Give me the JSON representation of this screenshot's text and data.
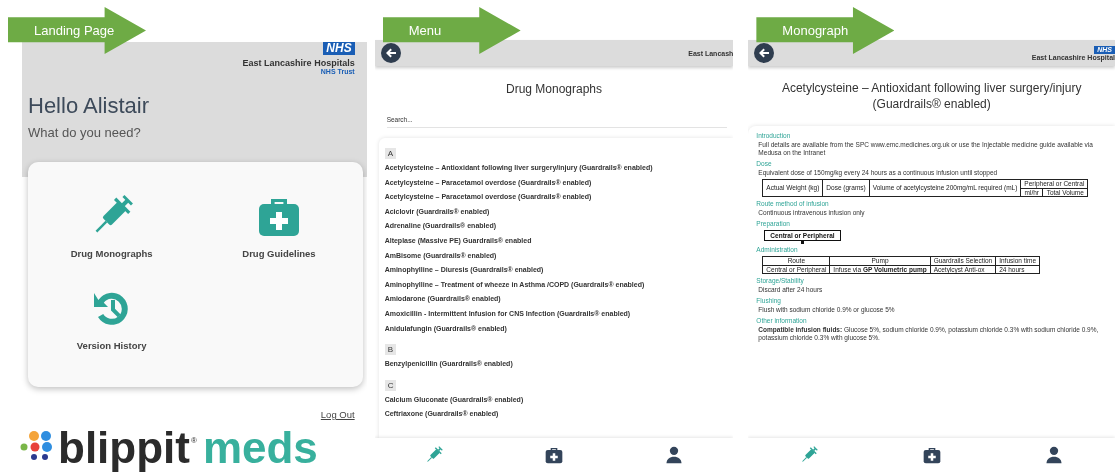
{
  "landing": {
    "banner": "Landing Page",
    "logo": {
      "badge": "NHS",
      "org": "East Lancashire Hospitals",
      "sub": "NHS Trust"
    },
    "greeting": "Hello Alistair",
    "prompt": "What do you need?",
    "tiles": [
      {
        "kind": "syringe",
        "label": "Drug Monographs"
      },
      {
        "kind": "kit",
        "label": "Drug Guidelines"
      },
      {
        "kind": "history",
        "label": "Version History"
      }
    ],
    "logout": "Log Out",
    "brand": {
      "word1": "blippit",
      "mark": "®",
      "word2": "meds"
    }
  },
  "menu": {
    "banner": "Menu",
    "org": "East Lancash",
    "title": "Drug Monographs",
    "search": {
      "placeholder": "Search..."
    },
    "groups": [
      {
        "letter": "A",
        "items": [
          "Acetylcysteine – Antioxidant following liver surgery/injury (Guardrails® enabled)",
          "Acetylcysteine – Paracetamol overdose (Guardrails® enabled)",
          "Acetylcysteine – Paracetamol overdose (Guardrails® enabled)",
          "Aciclovir (Guardrails® enabled)",
          "Adrenaline (Guardrails® enabled)",
          "Alteplase (Massive PE) Guardrails® enabled",
          "AmBisome (Guardrails® enabled)",
          "Aminophylline – Diuresis (Guardrails® enabled)",
          "Aminophylline – Treatment of wheeze in Asthma /COPD (Guardrails® enabled)",
          "Amiodarone (Guardrails® enabled)",
          "Amoxicillin - Intermittent Infusion for CNS Infection (Guardrails® enabled)",
          "Anidulafungin (Guardrails® enabled)"
        ]
      },
      {
        "letter": "B",
        "items": [
          "Benzylpenicillin (Guardrails® enabled)"
        ]
      },
      {
        "letter": "C",
        "items": [
          "Calcium Gluconate (Guardrails® enabled)",
          "Ceftriaxone (Guardrails® enabled)"
        ]
      }
    ],
    "nav": [
      {
        "kind": "syringe",
        "selected": true
      },
      {
        "kind": "kit",
        "selected": false
      },
      {
        "kind": "person",
        "selected": false
      }
    ]
  },
  "monograph": {
    "banner": "Monograph",
    "logo": {
      "badge": "NHS",
      "org": "East Lancashire Hospital"
    },
    "title": "Acetylcysteine – Antioxidant following liver surgery/injury (Guardrails® enabled)",
    "sections": [
      {
        "heading": "Introduction",
        "blocks": [
          {
            "kind": "text",
            "text": "Full details are available from the SPC www.emc.medicines.org.uk or use the Injectable medicine guide available via Medusa on the Intranet"
          }
        ]
      },
      {
        "heading": "Dose",
        "blocks": [
          {
            "kind": "text",
            "text": "Equivalent dose of 150mg/kg every 24 hours as a continuous infusion until stopped"
          },
          {
            "kind": "table",
            "columns": [
              {
                "label": "Actual Weight (kg)"
              },
              {
                "label": "Dose (grams)"
              },
              {
                "label": "Volume of acetylcysteine 200mg/mL required (mL)"
              },
              {
                "label": "Peripheral or Central",
                "sub": [
                  "ml/hr",
                  "Total Volume"
                ]
              }
            ]
          }
        ]
      },
      {
        "heading": "Route method of infusion",
        "blocks": [
          {
            "kind": "text",
            "text": "Continuous intravenous infusion only"
          }
        ]
      },
      {
        "heading": "Preparation",
        "blocks": [
          {
            "kind": "box",
            "text": "Central or Peripheral"
          }
        ]
      },
      {
        "heading": "Administration",
        "blocks": [
          {
            "kind": "table",
            "columns": [
              {
                "label": "Route"
              },
              {
                "label": "Pump"
              },
              {
                "label": "Guardrails Selection"
              },
              {
                "label": "Infusion time"
              }
            ],
            "rows": [
              [
                "Central or Peripheral",
                "Infuse via **GP Volumetric pump**",
                "Acetylcyst Anti-ox",
                "24 hours"
              ]
            ]
          }
        ]
      },
      {
        "heading": "Storage/Stability",
        "blocks": [
          {
            "kind": "text",
            "text": "Discard after 24 hours"
          }
        ]
      },
      {
        "heading": "Flushing",
        "blocks": [
          {
            "kind": "text",
            "text": "Flush with sodium chloride 0.9% or glucose 5%"
          }
        ]
      },
      {
        "heading": "Other information",
        "blocks": [
          {
            "kind": "text",
            "text": "**Compatible infusion fluids:** Glucose 5%, sodium chloride 0.9%, potassium chloride 0.3% with sodium chloride 0.9%, potassium chloride 0.3% with glucose 5%."
          }
        ]
      }
    ],
    "nav": [
      {
        "kind": "syringe",
        "selected": true
      },
      {
        "kind": "kit",
        "selected": false
      },
      {
        "kind": "person",
        "selected": false
      }
    ]
  }
}
